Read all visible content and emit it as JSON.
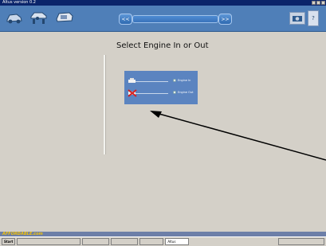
{
  "window": {
    "title": "Altus version 0.2"
  },
  "toolbar": {
    "back_nav_label": "<<",
    "forward_nav_label": ">>",
    "help_label": "?"
  },
  "main": {
    "heading": "Select Engine In or Out",
    "options": [
      {
        "label": "Engine In",
        "selected": false
      },
      {
        "label": "Engine Out",
        "selected": false
      }
    ]
  },
  "statusbar": {
    "brand": "AFFORDABLE.com"
  },
  "taskbar": {
    "start_label": "Start",
    "tasks": [
      "Altus"
    ]
  },
  "colors": {
    "toolbar_bg": "#4f7fb8",
    "panel_bg": "#5b84c0",
    "title_bg": "#0a246a",
    "annotation_arrow": "#000000"
  },
  "icons": [
    "car-icon",
    "car-lift-icon",
    "engine-icon",
    "camera-icon",
    "help-icon",
    "minimize-icon",
    "maximize-icon",
    "close-icon"
  ]
}
